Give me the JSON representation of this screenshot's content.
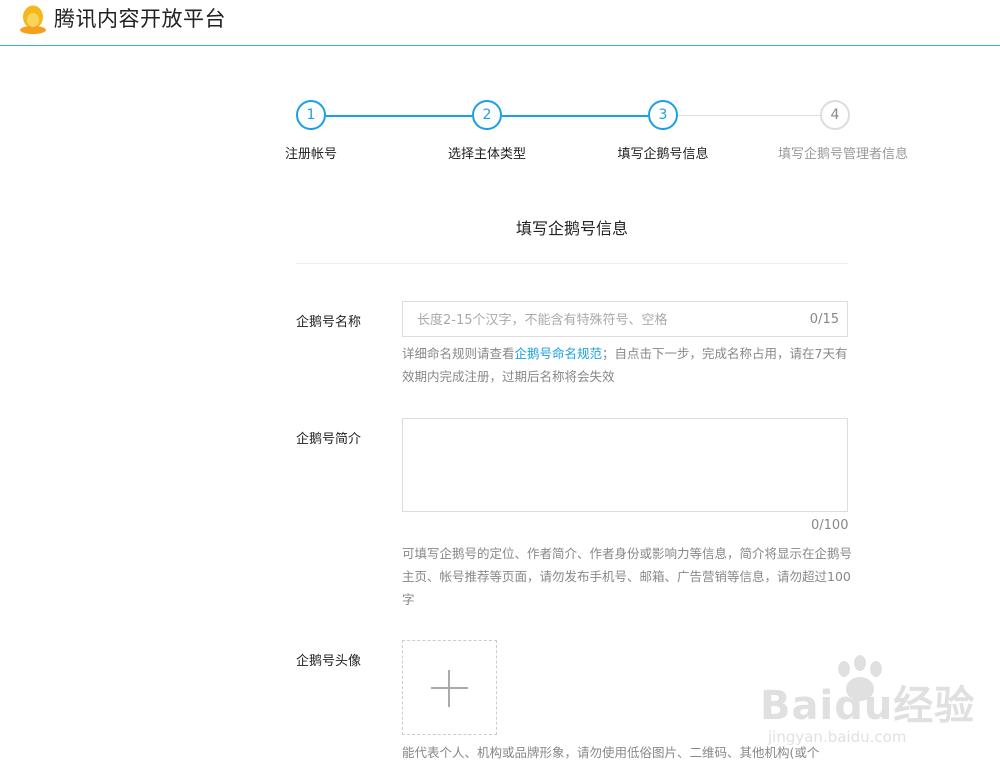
{
  "header": {
    "title": "腾讯内容开放平台"
  },
  "steps": {
    "current": 3,
    "items": [
      {
        "number": "1",
        "label": "注册帐号",
        "state": "done"
      },
      {
        "number": "2",
        "label": "选择主体类型",
        "state": "done"
      },
      {
        "number": "3",
        "label": "填写企鹅号信息",
        "state": "active"
      },
      {
        "number": "4",
        "label": "填写企鹅号管理者信息",
        "state": "todo"
      }
    ]
  },
  "colors": {
    "accent": "#1aa0e6",
    "inactive": "#dddddd"
  },
  "form": {
    "title": "填写企鹅号信息",
    "name": {
      "label": "企鹅号名称",
      "placeholder": "长度2-15个汉字，不能含有特殊符号、空格",
      "value": "",
      "counter": "0/15",
      "hint_before": "详细命名规则请查看",
      "hint_link": "企鹅号命名规范",
      "hint_after": "；自点击下一步，完成名称占用，请在7天有效期内完成注册，过期后名称将会失效"
    },
    "intro": {
      "label": "企鹅号简介",
      "value": "",
      "counter": "0/100",
      "hint": "可填写企鹅号的定位、作者简介、作者身份或影响力等信息，简介将显示在企鹅号主页、帐号推荐等页面，请勿发布手机号、邮箱、广告营销等信息，请勿超过100字"
    },
    "avatar": {
      "label": "企鹅号头像",
      "upload_icon": "plus-icon",
      "hint": "能代表个人、机构或品牌形象，请勿使用低俗图片、二维码、其他机构(或个"
    }
  },
  "watermark": {
    "text": "Baidu经验",
    "sub": "jingyan.baidu.com"
  }
}
